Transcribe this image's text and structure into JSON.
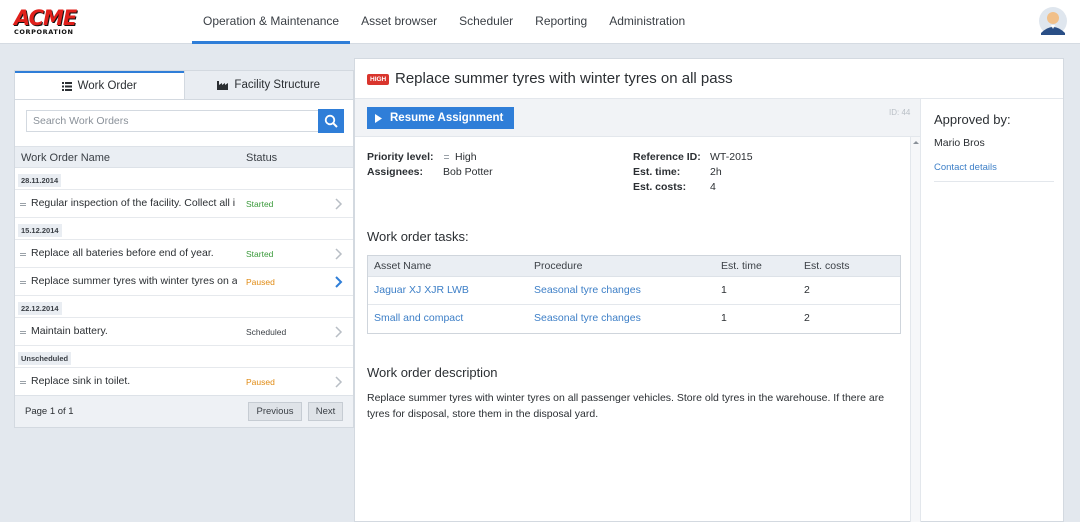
{
  "brand": {
    "logo_text": "ACME",
    "logo_subtext": "CORPORATION"
  },
  "nav": {
    "items": [
      {
        "label": "Operation & Maintenance",
        "active": true
      },
      {
        "label": "Asset browser"
      },
      {
        "label": "Scheduler"
      },
      {
        "label": "Reporting"
      },
      {
        "label": "Administration"
      }
    ],
    "user_icon": "user-avatar-icon"
  },
  "left": {
    "tabs": [
      {
        "label": "Work Order",
        "icon": "list-icon",
        "active": true
      },
      {
        "label": "Facility Structure",
        "icon": "factory-icon"
      }
    ],
    "search": {
      "placeholder": "Search Work Orders",
      "icon": "search-icon"
    },
    "columns": {
      "name": "Work Order Name",
      "status": "Status"
    },
    "groups": [
      {
        "label": "28.11.2014",
        "rows": [
          {
            "name": "Regular inspection of the facility. Collect all i",
            "status": "Started"
          }
        ]
      },
      {
        "label": "15.12.2014",
        "rows": [
          {
            "name": "Replace all bateries before end of year.",
            "status": "Started"
          },
          {
            "name": "Replace summer tyres with winter tyres on all",
            "status": "Paused",
            "selected": true
          }
        ]
      },
      {
        "label": "22.12.2014",
        "rows": [
          {
            "name": "Maintain battery.",
            "status": "Scheduled"
          }
        ]
      },
      {
        "label": "Unscheduled",
        "rows": [
          {
            "name": "Replace sink in toilet.",
            "status": "Paused"
          }
        ]
      }
    ],
    "pager": {
      "info": "Page 1 of 1",
      "prev": "Previous",
      "next": "Next"
    }
  },
  "main": {
    "priority_badge": "HIGH",
    "title": "Replace summer tyres with winter tyres on all pass",
    "resume_label": "Resume Assignment",
    "id_label": "ID: 44",
    "details": {
      "priority_label": "Priority level:",
      "priority_value": "High",
      "assignees_label": "Assignees:",
      "assignees_value": "Bob Potter",
      "ref_label": "Reference ID:",
      "ref_value": "WT-2015",
      "time_label": "Est. time:",
      "time_value": "2h",
      "costs_label": "Est. costs:",
      "costs_value": "4"
    },
    "tasks_title": "Work order tasks:",
    "tasks_columns": [
      "Asset Name",
      "Procedure",
      "Est. time",
      "Est. costs"
    ],
    "tasks": [
      {
        "asset": "Jaguar XJ XJR LWB",
        "procedure": "Seasonal tyre changes",
        "time": "1",
        "costs": "2"
      },
      {
        "asset": "Small and compact",
        "procedure": "Seasonal tyre changes",
        "time": "1",
        "costs": "2"
      }
    ],
    "desc_title": "Work order description",
    "description": "Replace summer tyres with winter tyres on all passenger vehicles. Store old tyres in the warehouse. If there are tyres for disposal, store them in the disposal yard."
  },
  "side": {
    "title": "Approved by:",
    "name": "Mario Bros",
    "contact": "Contact details"
  },
  "colors": {
    "accent": "#2f7ed8",
    "high": "#d9352d",
    "started": "#3a9a3a",
    "paused": "#e08a12",
    "link": "#3d7fc7"
  }
}
